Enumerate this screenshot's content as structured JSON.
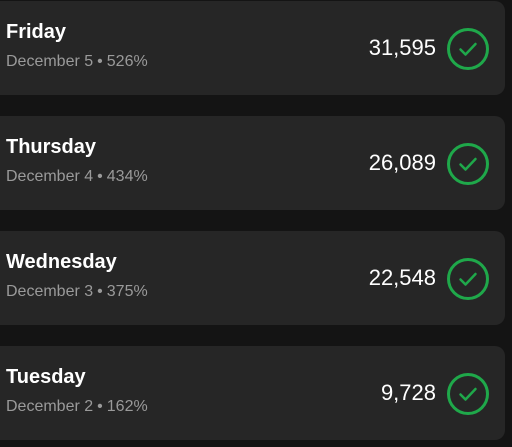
{
  "theme": {
    "background": "#141414",
    "card_background": "#262626",
    "primary_text": "#ffffff",
    "secondary_text": "#9a9a9a",
    "accent_green": "#1fa84a"
  },
  "days": [
    {
      "day": "Friday",
      "date": "December 5",
      "percent": "526%",
      "count": "31,595",
      "separator": "•",
      "status_icon": "check-circle-icon",
      "completed": true
    },
    {
      "day": "Thursday",
      "date": "December 4",
      "percent": "434%",
      "count": "26,089",
      "separator": "•",
      "status_icon": "check-circle-icon",
      "completed": true
    },
    {
      "day": "Wednesday",
      "date": "December 3",
      "percent": "375%",
      "count": "22,548",
      "separator": "•",
      "status_icon": "check-circle-icon",
      "completed": true
    },
    {
      "day": "Tuesday",
      "date": "December 2",
      "percent": "162%",
      "count": "9,728",
      "separator": "•",
      "status_icon": "check-circle-icon",
      "completed": true
    }
  ]
}
